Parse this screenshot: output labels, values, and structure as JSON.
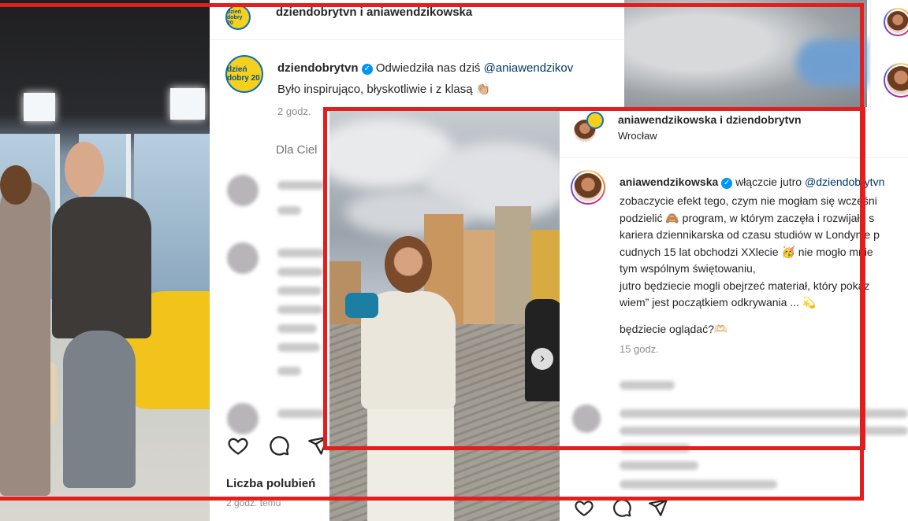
{
  "post_back": {
    "header_users": "dziendobrytvn i aniawendzikowska",
    "author": "dziendobrytvn",
    "caption_line1": "Odwiedziła nas dziś ",
    "caption_mention": "@aniawendzikov",
    "caption_line2": "Było inspirująco, błyskotliwie i z klasą 👏🏼",
    "time": "2 godz.",
    "for_you_label": "Dla Ciel",
    "likes_label": "Liczba polubień",
    "footer_time": "2 godz. temu",
    "avatar_label": "dzień dobry 20"
  },
  "post_front": {
    "header_users": "aniawendzikowska i dziendobrytvn",
    "location": "Wrocław",
    "author": "aniawendzikowska",
    "caption_lead": "włączcie jutro ",
    "caption_mention": "@dziendobrytvn",
    "caption_lines": [
      "zobaczycie efekt tego, czym nie mogłam się wcześni",
      "podzielić 🙈 program, w którym zaczęła i rozwijała s",
      "kariera dziennikarska od czasu studiów w Londynie p",
      "cudnych 15 lat obchodzi XXlecie 🥳 nie mogło mnie",
      "tym wspólnym świętowaniu,",
      "jutro będziecie mogli obejrzeć materiał, który pokaz",
      "wiem” jest początkiem odkrywania ... 💫"
    ],
    "question": "będziecie oglądać?🫶🏻",
    "time": "15 godz."
  },
  "icons": {
    "like": "heart-icon",
    "comment": "comment-icon",
    "share": "share-icon",
    "verified": "verified-badge-icon",
    "carousel_next": "chevron-right-icon"
  },
  "colors": {
    "highlight": "#e41d1d",
    "verified": "#0095f6",
    "mention": "#00376b"
  }
}
